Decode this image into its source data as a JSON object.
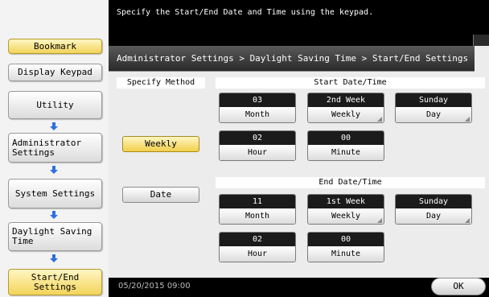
{
  "message": "Specify the Start/End Date and Time using the keypad.",
  "sidebar": {
    "bookmark": "Bookmark",
    "display_keypad": "Display Keypad",
    "utility": "Utility",
    "admin_settings": "Administrator Settings",
    "system_settings": "System Settings",
    "daylight_saving": "Daylight Saving Time",
    "start_end": "Start/End Settings"
  },
  "breadcrumb": "Administrator Settings > Daylight Saving Time > Start/End Settings",
  "specify_method": {
    "label": "Specify Method",
    "weekly": "Weekly",
    "date": "Date",
    "selected": "Weekly"
  },
  "start": {
    "title": "Start Date/Time",
    "month_value": "03",
    "month_label": "Month",
    "week_value": "2nd Week",
    "week_label": "Weekly",
    "day_value": "Sunday",
    "day_label": "Day",
    "hour_value": "02",
    "hour_label": "Hour",
    "minute_value": "00",
    "minute_label": "Minute"
  },
  "end": {
    "title": "End Date/Time",
    "month_value": "11",
    "month_label": "Month",
    "week_value": "1st Week",
    "week_label": "Weekly",
    "day_value": "Sunday",
    "day_label": "Day",
    "hour_value": "02",
    "hour_label": "Hour",
    "minute_value": "00",
    "minute_label": "Minute"
  },
  "footer": {
    "datetime": "05/20/2015  09:00",
    "ok": "OK"
  },
  "colors": {
    "highlight": "#f2d45a",
    "panel": "#ececec",
    "dark": "#1b1b1b"
  }
}
